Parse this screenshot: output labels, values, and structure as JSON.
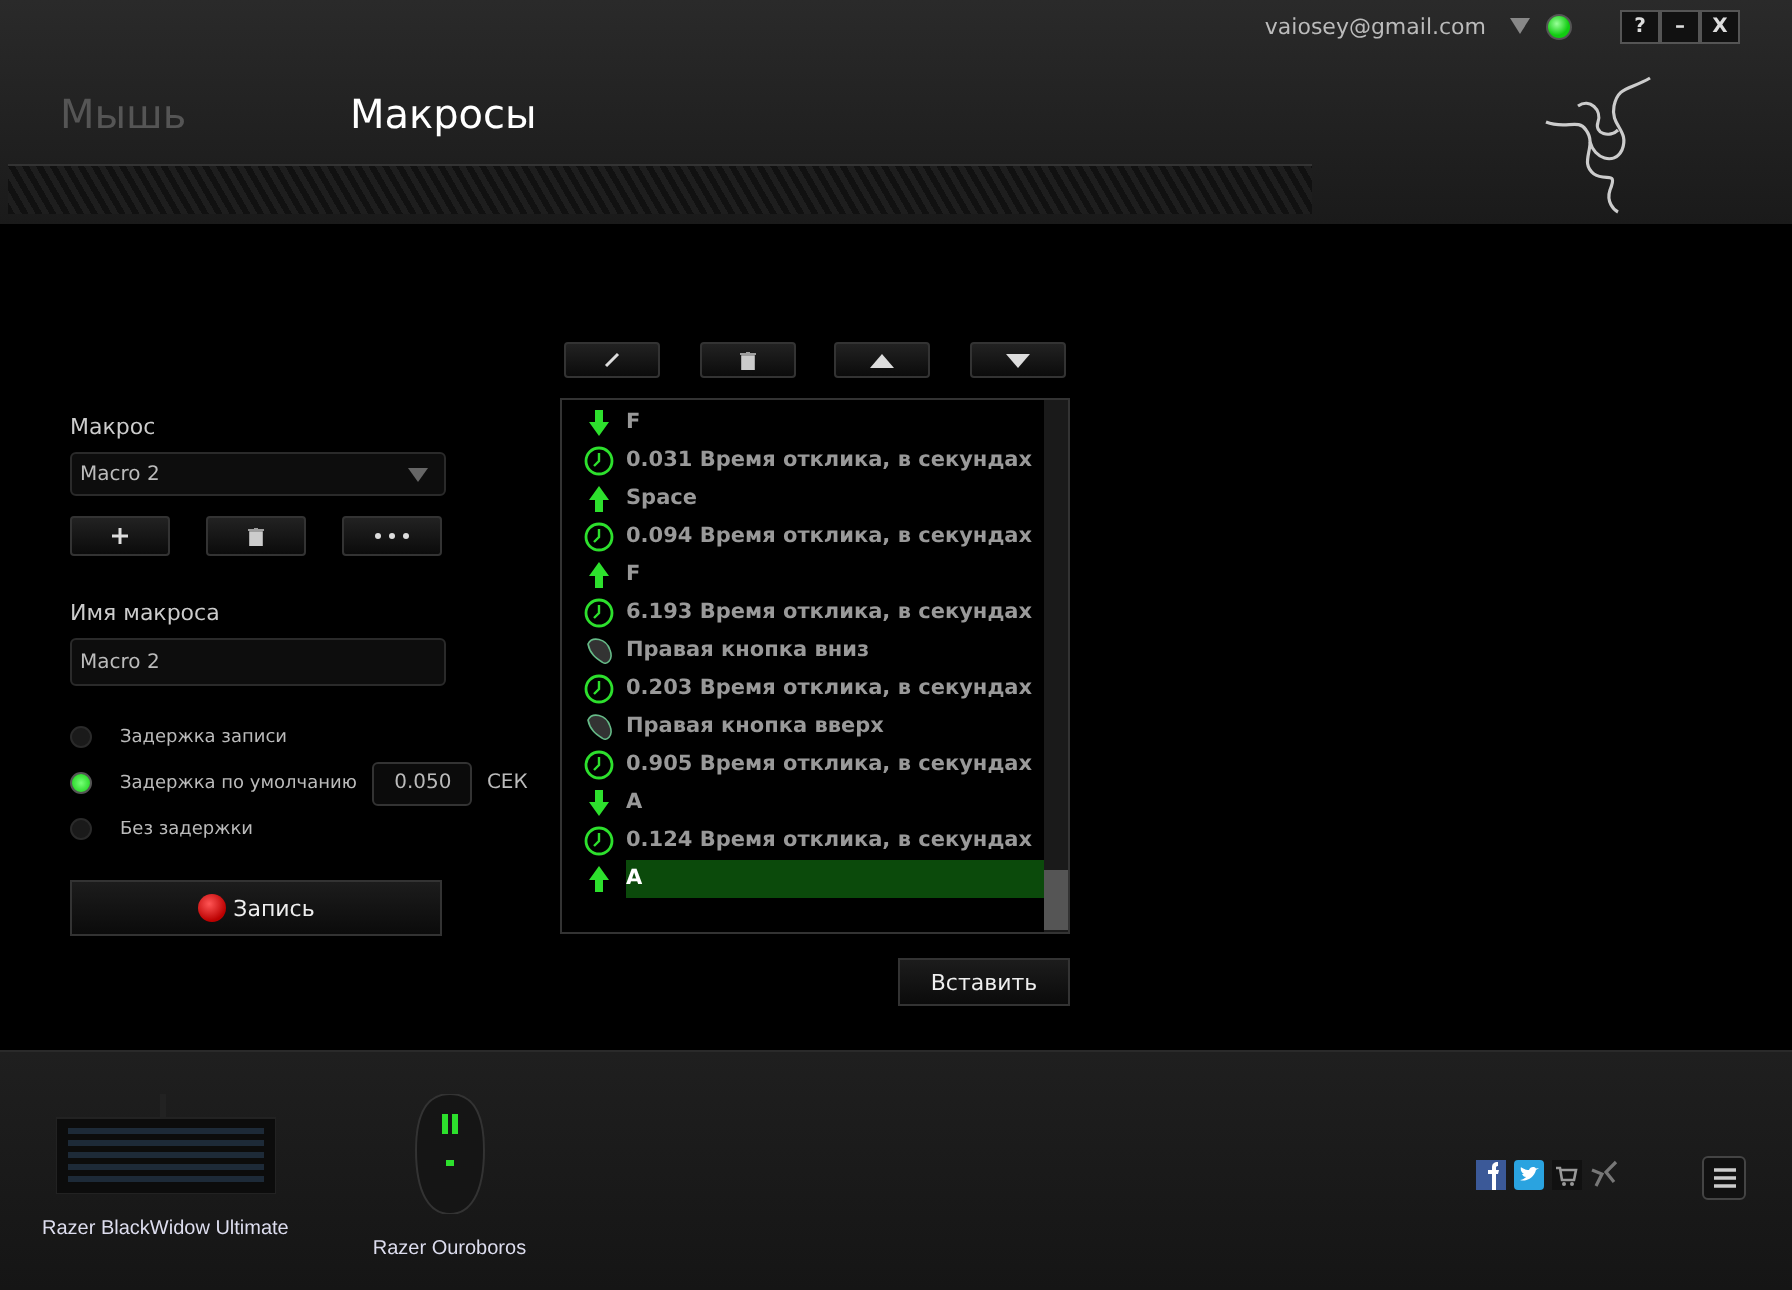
{
  "account": {
    "email": "vaiosey@gmail.com",
    "online": true
  },
  "window_buttons": [
    "?",
    "–",
    "X"
  ],
  "tabs": [
    {
      "label": "Мышь",
      "selected": false
    },
    {
      "label": "Макросы",
      "selected": true
    }
  ],
  "macro_panel": {
    "macro_label": "Макрос",
    "macro_select": "Macro 2",
    "name_label": "Имя макроса",
    "name_value": "Macro 2",
    "delay_options": [
      {
        "label": "Задержка записи",
        "selected": false
      },
      {
        "label": "Задержка по умолчанию",
        "selected": true
      },
      {
        "label": "Без задержки",
        "selected": false
      }
    ],
    "default_delay": "0.050",
    "delay_unit": "СЕК",
    "record_button": "Запись"
  },
  "events": [
    {
      "kind": "key_down",
      "text": "F",
      "selected": false
    },
    {
      "kind": "delay",
      "text": "0.031 Время отклика, в секундах",
      "selected": false
    },
    {
      "kind": "key_up",
      "text": "Space",
      "selected": false
    },
    {
      "kind": "delay",
      "text": "0.094 Время отклика, в секундах",
      "selected": false
    },
    {
      "kind": "key_up",
      "text": "F",
      "selected": false
    },
    {
      "kind": "delay",
      "text": "6.193 Время отклика, в секундах",
      "selected": false
    },
    {
      "kind": "mouse",
      "text": "Правая кнопка вниз",
      "selected": false
    },
    {
      "kind": "delay",
      "text": "0.203 Время отклика, в секундах",
      "selected": false
    },
    {
      "kind": "mouse",
      "text": "Правая кнопка вверх",
      "selected": false
    },
    {
      "kind": "delay",
      "text": "0.905 Время отклика, в секундах",
      "selected": false
    },
    {
      "kind": "key_down",
      "text": "A",
      "selected": false
    },
    {
      "kind": "delay",
      "text": "0.124 Время отклика, в секундах",
      "selected": false
    },
    {
      "kind": "key_up",
      "text": "A",
      "selected": true
    }
  ],
  "insert_button": "Вставить",
  "devices": [
    {
      "kind": "keyboard",
      "name": "Razer BlackWidow Ultimate"
    },
    {
      "kind": "mouse",
      "name": "Razer Ouroboros"
    }
  ]
}
